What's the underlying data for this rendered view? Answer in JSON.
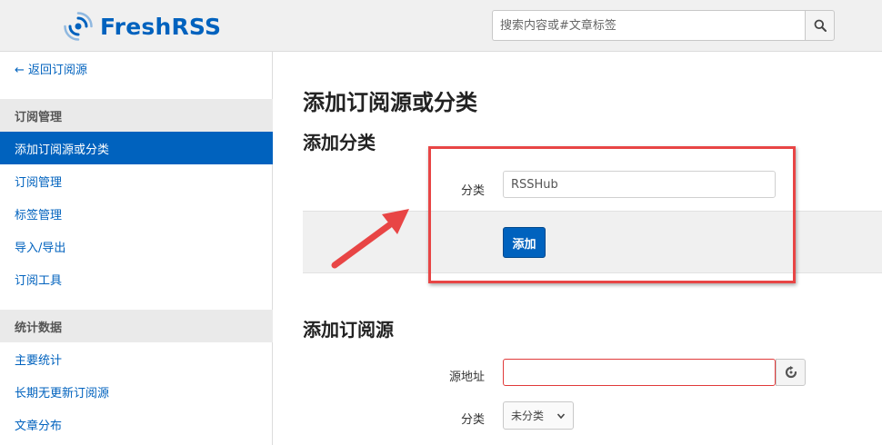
{
  "header": {
    "app_name": "FreshRSS",
    "search": {
      "placeholder": "搜索内容或#文章标签",
      "value": ""
    }
  },
  "sidebar": {
    "back_label": "← 返回订阅源",
    "sections": [
      {
        "title": "订阅管理",
        "items": [
          "添加订阅源或分类",
          "订阅管理",
          "标签管理",
          "导入/导出",
          "订阅工具"
        ]
      },
      {
        "title": "统计数据",
        "items": [
          "主要统计",
          "长期无更新订阅源",
          "文章分布"
        ]
      }
    ],
    "active_item": "添加订阅源或分类"
  },
  "main": {
    "page_title": "添加订阅源或分类",
    "category_section": {
      "title": "添加分类",
      "label": "分类",
      "input_value": "RSSHub",
      "submit_label": "添加"
    },
    "feed_section": {
      "title": "添加订阅源",
      "url_label": "源地址",
      "url_value": "",
      "category_label": "分类",
      "category_selected": "未分类"
    }
  },
  "colors": {
    "accent": "#0062be",
    "annotation": "#e84545"
  },
  "icons": [
    "freshrss-logo-icon",
    "search-icon",
    "refresh-icon",
    "chevron-down-icon",
    "annotation-arrow"
  ]
}
